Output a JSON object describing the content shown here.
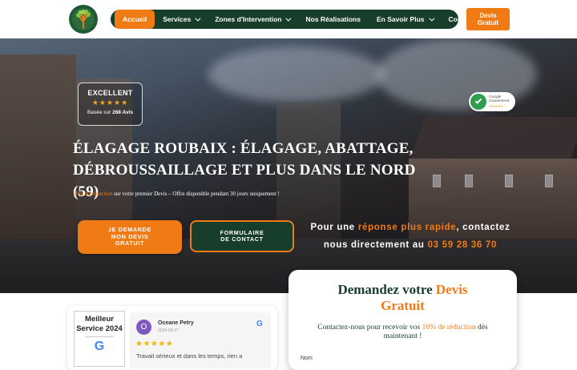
{
  "header": {
    "logo_icon": "tree-logo-icon",
    "nav": [
      {
        "label": "Accueil",
        "active": true,
        "dropdown": false
      },
      {
        "label": "Services",
        "active": false,
        "dropdown": true
      },
      {
        "label": "Zones d'Intervention",
        "active": false,
        "dropdown": true
      },
      {
        "label": "Nos Réalisations",
        "active": false,
        "dropdown": false
      },
      {
        "label": "En Savoir Plus",
        "active": false,
        "dropdown": true
      },
      {
        "label": "Contact",
        "active": false,
        "dropdown": false
      }
    ],
    "devis_line1": "Devis",
    "devis_line2": "Gratuit"
  },
  "hero": {
    "review_box": {
      "title": "EXCELLENT",
      "stars": "★★★★★",
      "based_prefix": "Basée sur ",
      "based_count": "268 Avis"
    },
    "google_badge": {
      "line1": "Google",
      "line2": "Guaranteed",
      "stars": "★★★★★"
    },
    "title_line1": "ÉLAGAGE ROUBAIX : ÉLAGAGE, ABATTAGE,",
    "title_line2": "DÉBROUSSAILLAGE ET PLUS DANS LE NORD (59)",
    "offer_highlight": "10% de réduction",
    "offer_rest": " sur votre premier Devis – Offre disponible pendant 30 jours uniquement !",
    "btn_primary_l1": "JE DEMANDE",
    "btn_primary_l2": "MON DEVIS",
    "btn_primary_l3": "GRATUIT",
    "btn_secondary_l1": "FORMULAIRE",
    "btn_secondary_l2": "DE CONTACT",
    "cta_prefix": "Pour une ",
    "cta_highlight": "réponse plus rapide",
    "cta_mid": ", contactez",
    "cta_line2_prefix": "nous directement au ",
    "cta_phone": "03 59 28 36 70"
  },
  "reviews": {
    "best_line1": "Meilleur",
    "best_line2": "Service 2024",
    "google_letter": "G",
    "card": {
      "avatar_letter": "O",
      "name": "Oceane Petry",
      "date": "2024-08-17",
      "g_letter": "G",
      "stars": "★★★★★",
      "text": "Travail sérieux et dans les temps, rien a"
    }
  },
  "form": {
    "title_prefix": "Demandez votre ",
    "title_highlight": "Devis",
    "title_line2": "Gratuit",
    "sub_prefix": "Contactez-nous pour recevoir vos ",
    "sub_highlight": "10% de réduction",
    "sub_suffix": " dès",
    "sub_line2": "maintenant !",
    "first_label": "Nom"
  }
}
